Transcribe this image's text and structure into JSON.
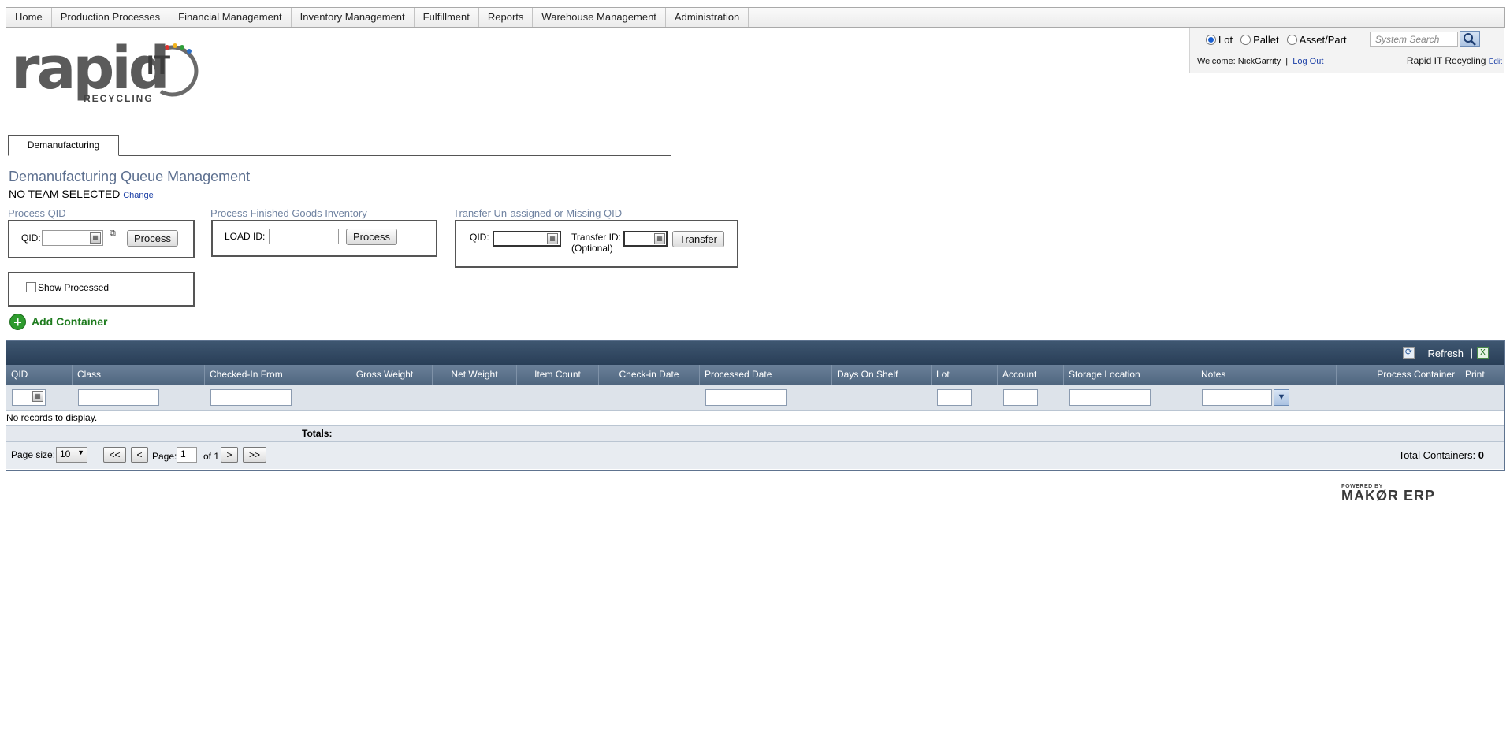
{
  "nav": {
    "items": [
      "Home",
      "Production Processes",
      "Financial Management",
      "Inventory Management",
      "Fulfillment",
      "Reports",
      "Warehouse Management",
      "Administration"
    ]
  },
  "logo": {
    "word": "rapid",
    "it": "IT",
    "sub": "RECYCLING"
  },
  "system": {
    "radios": [
      {
        "label": "Lot",
        "checked": true
      },
      {
        "label": "Pallet",
        "checked": false
      },
      {
        "label": "Asset/Part",
        "checked": false
      }
    ],
    "search_placeholder": "System Search",
    "welcome": "Welcome: NickGarrity",
    "sep": "|",
    "logout": "Log Out",
    "company": "Rapid IT Recycling",
    "edit": "Edit"
  },
  "tab": {
    "label": "Demanufacturing"
  },
  "page": {
    "title": "Demanufacturing Queue Management",
    "team": "NO TEAM SELECTED",
    "change": "Change"
  },
  "process_qid": {
    "title": "Process QID",
    "label": "QID:",
    "button": "Process"
  },
  "finished_goods": {
    "title": "Process Finished Goods Inventory",
    "label": "LOAD ID:",
    "button": "Process"
  },
  "transfer": {
    "title": "Transfer Un-assigned or Missing QID",
    "qid_label": "QID:",
    "transfer_label": "Transfer ID:",
    "optional": "(Optional)",
    "button": "Transfer"
  },
  "show_processed": "Show Processed",
  "add_container": "Add Container",
  "grid": {
    "refresh": "Refresh",
    "columns": [
      "QID",
      "Class",
      "Checked-In From",
      "Gross Weight",
      "Net Weight",
      "Item Count",
      "Check-in Date",
      "Processed Date",
      "Days On Shelf",
      "Lot",
      "Account",
      "Storage Location",
      "Notes",
      "Process Container",
      "Print"
    ],
    "no_records": "No records to display.",
    "totals": "Totals:",
    "page_size_label": "Page size:",
    "page_size": "10",
    "first": "<<",
    "prev": "<",
    "page_label": "Page:",
    "page": "1",
    "of": "of 1",
    "next": ">",
    "last": ">>",
    "total_containers_label": "Total Containers:",
    "total_containers": "0"
  },
  "footer": {
    "powered": "POWERED BY",
    "brand": "MAKØR ERP"
  },
  "colors": {
    "header_dark": "#293e57",
    "accent_blue": "#5c6f8f",
    "add_green": "#2e9b2e"
  }
}
